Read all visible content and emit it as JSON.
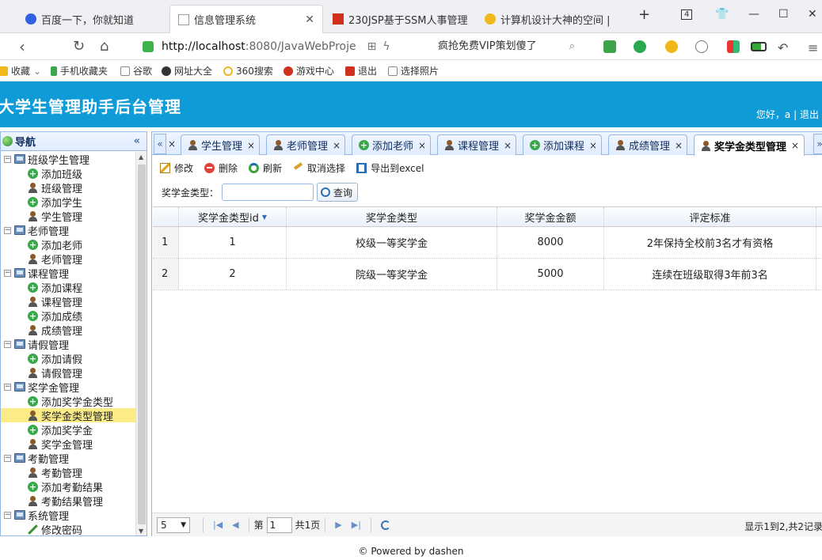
{
  "browser": {
    "tabs": [
      {
        "title": "百度一下，你就知道",
        "color": "#2f62e0"
      },
      {
        "title": "信息管理系统",
        "color": "#999999"
      },
      {
        "title": "230JSP基于SSM人事管理",
        "color": "#d0301e"
      },
      {
        "title": "计算机设计大神的空间 |",
        "color": "#f2b81a"
      }
    ],
    "tab_count": "4",
    "new_tab": "+",
    "url_host": "http://localhost",
    "url_path": ":8080/JavaWebProje",
    "search_text": "疯抢免费VIP策划傻了",
    "bookmarks": [
      "收藏",
      "手机收藏夹",
      "谷歌",
      "网址大全",
      "360搜索",
      "游戏中心",
      "退出",
      "选择照片"
    ]
  },
  "app": {
    "title": "大学生管理助手后台管理",
    "greeting": "您好，a",
    "sep": "|",
    "logout": "退出"
  },
  "nav": {
    "title": "导航",
    "collapse": "«",
    "groups": [
      {
        "label": "班级学生管理",
        "items": [
          {
            "label": "添加班级",
            "icon": "add-icon"
          },
          {
            "label": "班级管理",
            "icon": "user-icon"
          },
          {
            "label": "添加学生",
            "icon": "add-icon"
          },
          {
            "label": "学生管理",
            "icon": "user-icon"
          }
        ]
      },
      {
        "label": "老师管理",
        "items": [
          {
            "label": "添加老师",
            "icon": "add-icon"
          },
          {
            "label": "老师管理",
            "icon": "user-icon"
          }
        ]
      },
      {
        "label": "课程管理",
        "items": [
          {
            "label": "添加课程",
            "icon": "add-icon"
          },
          {
            "label": "课程管理",
            "icon": "user-icon"
          },
          {
            "label": "添加成绩",
            "icon": "add-icon"
          },
          {
            "label": "成绩管理",
            "icon": "user-icon"
          }
        ]
      },
      {
        "label": "请假管理",
        "items": [
          {
            "label": "添加请假",
            "icon": "add-icon"
          },
          {
            "label": "请假管理",
            "icon": "user-icon"
          }
        ]
      },
      {
        "label": "奖学金管理",
        "items": [
          {
            "label": "添加奖学金类型",
            "icon": "add-icon"
          },
          {
            "label": "奖学金类型管理",
            "icon": "user-icon",
            "selected": true
          },
          {
            "label": "添加奖学金",
            "icon": "add-icon"
          },
          {
            "label": "奖学金管理",
            "icon": "user-icon"
          }
        ]
      },
      {
        "label": "考勤管理",
        "items": [
          {
            "label": "考勤管理",
            "icon": "user-icon"
          },
          {
            "label": "添加考勤结果",
            "icon": "add-icon"
          },
          {
            "label": "考勤结果管理",
            "icon": "user-icon"
          }
        ]
      },
      {
        "label": "系统管理",
        "items": [
          {
            "label": "修改密码",
            "icon": "pen-icon"
          }
        ]
      }
    ]
  },
  "tabs": {
    "scroll_left": "«",
    "scroll_right": "»",
    "close": "×",
    "items": [
      {
        "label": "学生管理",
        "icon": "user-icon"
      },
      {
        "label": "老师管理",
        "icon": "user-icon"
      },
      {
        "label": "添加老师",
        "icon": "add-icon"
      },
      {
        "label": "课程管理",
        "icon": "user-icon"
      },
      {
        "label": "添加课程",
        "icon": "add-icon"
      },
      {
        "label": "成绩管理",
        "icon": "user-icon"
      },
      {
        "label": "奖学金类型管理",
        "icon": "user-icon",
        "active": true
      }
    ]
  },
  "toolbar": {
    "edit": "修改",
    "delete": "删除",
    "refresh": "刷新",
    "cancel_select": "取消选择",
    "export": "导出到excel"
  },
  "search": {
    "label": "奖学金类型：",
    "value": "",
    "button": "查询"
  },
  "grid": {
    "columns": [
      "奖学金类型id",
      "奖学金类型",
      "奖学金金额",
      "评定标准"
    ],
    "sort_indicator": "▼",
    "rows": [
      {
        "num": "1",
        "id": "1",
        "type": "校级一等奖学金",
        "amount": "8000",
        "standard": "2年保持全校前3名才有资格"
      },
      {
        "num": "2",
        "id": "2",
        "type": "院级一等奖学金",
        "amount": "5000",
        "standard": "连续在班级取得3年前3名"
      }
    ]
  },
  "pager": {
    "page_size": "5",
    "page_label": "第",
    "page_value": "1",
    "total_pages": "共1页",
    "info": "显示1到2,共2记录"
  },
  "footer": "© Powered by dashen"
}
